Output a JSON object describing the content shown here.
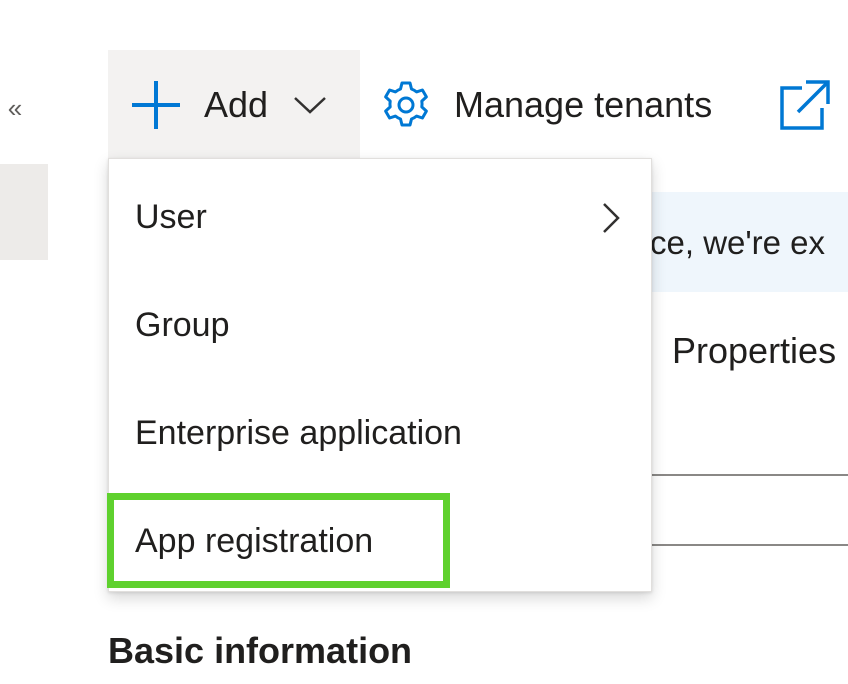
{
  "nav": {
    "collapse_glyph": "«"
  },
  "command_bar": {
    "add": {
      "label": "Add",
      "icon": "plus-icon",
      "chevron": "chevron-down-icon"
    },
    "manage_tenants": {
      "label": "Manage tenants",
      "icon": "gear-icon"
    },
    "open_external": {
      "icon": "open-in-new-window-icon"
    }
  },
  "background": {
    "banner_text": "ce, we're ex",
    "properties_text": "Properties",
    "basic_information_title": "Basic information"
  },
  "add_menu": {
    "items": [
      {
        "label": "User",
        "has_submenu": true
      },
      {
        "label": "Group",
        "has_submenu": false
      },
      {
        "label": "Enterprise application",
        "has_submenu": false
      },
      {
        "label": "App registration",
        "has_submenu": false,
        "highlighted": true
      }
    ]
  },
  "colors": {
    "accent": "#0078d4",
    "highlight": "#5fd12e",
    "command_hover": "#f3f2f1",
    "banner_bg": "#eff6fc"
  }
}
